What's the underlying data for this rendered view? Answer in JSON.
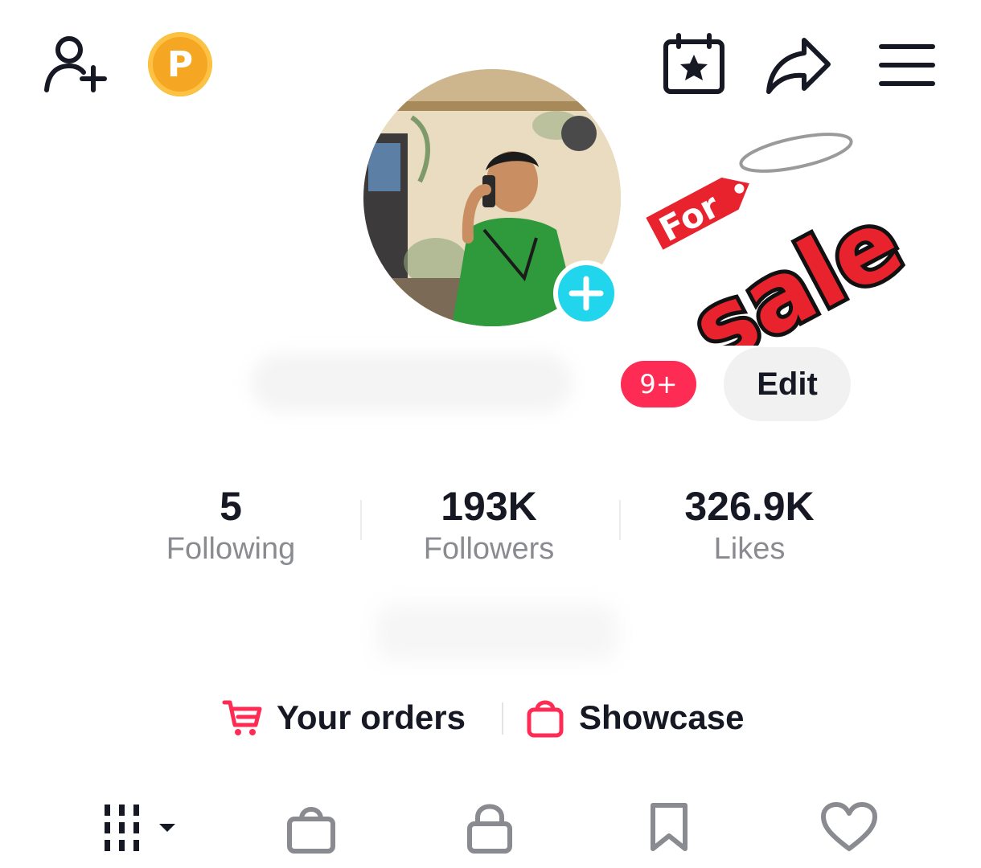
{
  "header": {
    "points_badge_letter": "P",
    "icons": [
      "add-friend-icon",
      "points-icon",
      "calendar-star-icon",
      "share-icon",
      "menu-icon"
    ]
  },
  "avatar": {
    "add_icon": "plus-icon"
  },
  "sticker": {
    "line1": "For",
    "line2": "sale"
  },
  "profile": {
    "notification_count": "9+",
    "edit_label": "Edit"
  },
  "stats": [
    {
      "value": "5",
      "label": "Following"
    },
    {
      "value": "193K",
      "label": "Followers"
    },
    {
      "value": "326.9K",
      "label": "Likes"
    }
  ],
  "links": {
    "orders_label": "Your orders",
    "showcase_label": "Showcase"
  },
  "tabs": [
    "videos-grid-icon",
    "shop-bag-icon",
    "lock-icon",
    "bookmark-icon",
    "heart-icon"
  ],
  "colors": {
    "accent": "#fe2c55",
    "avatar_plus": "#20d5ec",
    "points": "#f5a623",
    "muted_text": "#8a8b91"
  }
}
